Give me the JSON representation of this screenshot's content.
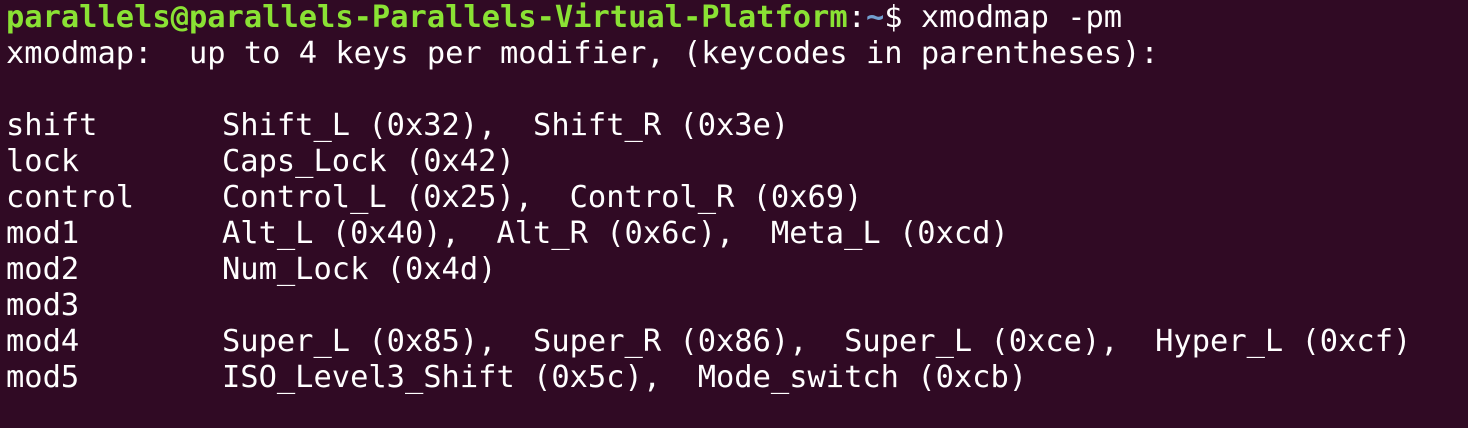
{
  "window": {
    "background": "#300a24",
    "text_color": "#ffffff",
    "prompt_user_color": "#8ae234",
    "prompt_path_color": "#729fcf"
  },
  "prompt": {
    "user_host": "parallels@parallels-Parallels-Virtual-Platform",
    "colon": ":",
    "path": "~",
    "symbol": "$ ",
    "command": "xmodmap -pm"
  },
  "output": {
    "header": "xmodmap:  up to 4 keys per modifier, (keycodes in parentheses):",
    "blank": "",
    "modifiers": [
      {
        "name": "shift",
        "keys": "Shift_L (0x32),  Shift_R (0x3e)"
      },
      {
        "name": "lock",
        "keys": "Caps_Lock (0x42)"
      },
      {
        "name": "control",
        "keys": "Control_L (0x25),  Control_R (0x69)"
      },
      {
        "name": "mod1",
        "keys": "Alt_L (0x40),  Alt_R (0x6c),  Meta_L (0xcd)"
      },
      {
        "name": "mod2",
        "keys": "Num_Lock (0x4d)"
      },
      {
        "name": "mod3",
        "keys": ""
      },
      {
        "name": "mod4",
        "keys": "Super_L (0x85),  Super_R (0x86),  Super_L (0xce),  Hyper_L (0xcf)"
      },
      {
        "name": "mod5",
        "keys": "ISO_Level3_Shift (0x5c),  Mode_switch (0xcb)"
      }
    ]
  }
}
